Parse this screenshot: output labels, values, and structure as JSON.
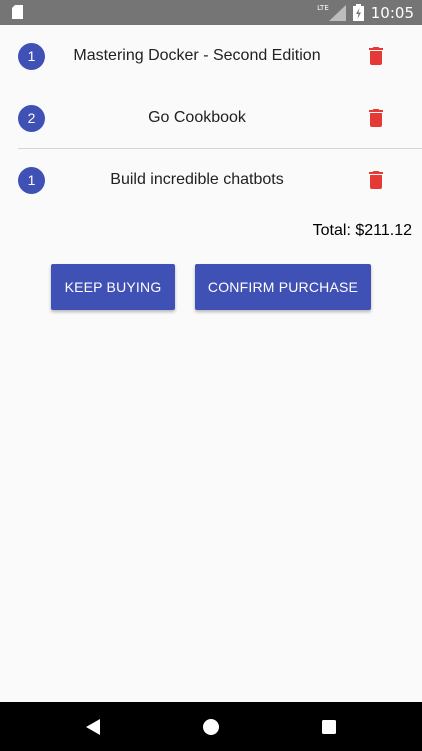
{
  "status_bar": {
    "network_label": "LTE",
    "time": "10:05",
    "icons": [
      "sim-card-icon",
      "signal-icon",
      "battery-charging-icon"
    ]
  },
  "cart": {
    "items": [
      {
        "quantity": "1",
        "title": "Mastering Docker - Second Edition",
        "delete_icon": "trash-icon"
      },
      {
        "quantity": "2",
        "title": "Go Cookbook",
        "delete_icon": "trash-icon"
      },
      {
        "quantity": "1",
        "title": "Build incredible chatbots",
        "delete_icon": "trash-icon"
      }
    ],
    "total_label": "Total: $211.12"
  },
  "actions": {
    "keep_buying_label": "KEEP BUYING",
    "confirm_purchase_label": "CONFIRM PURCHASE"
  },
  "nav_bar": {
    "icons": [
      "back-icon",
      "home-icon",
      "recents-icon"
    ]
  },
  "colors": {
    "primary": "#3f51b5",
    "delete": "#e53935",
    "status_bar": "#757575",
    "background": "#fafafa",
    "nav_bar": "#000000"
  }
}
